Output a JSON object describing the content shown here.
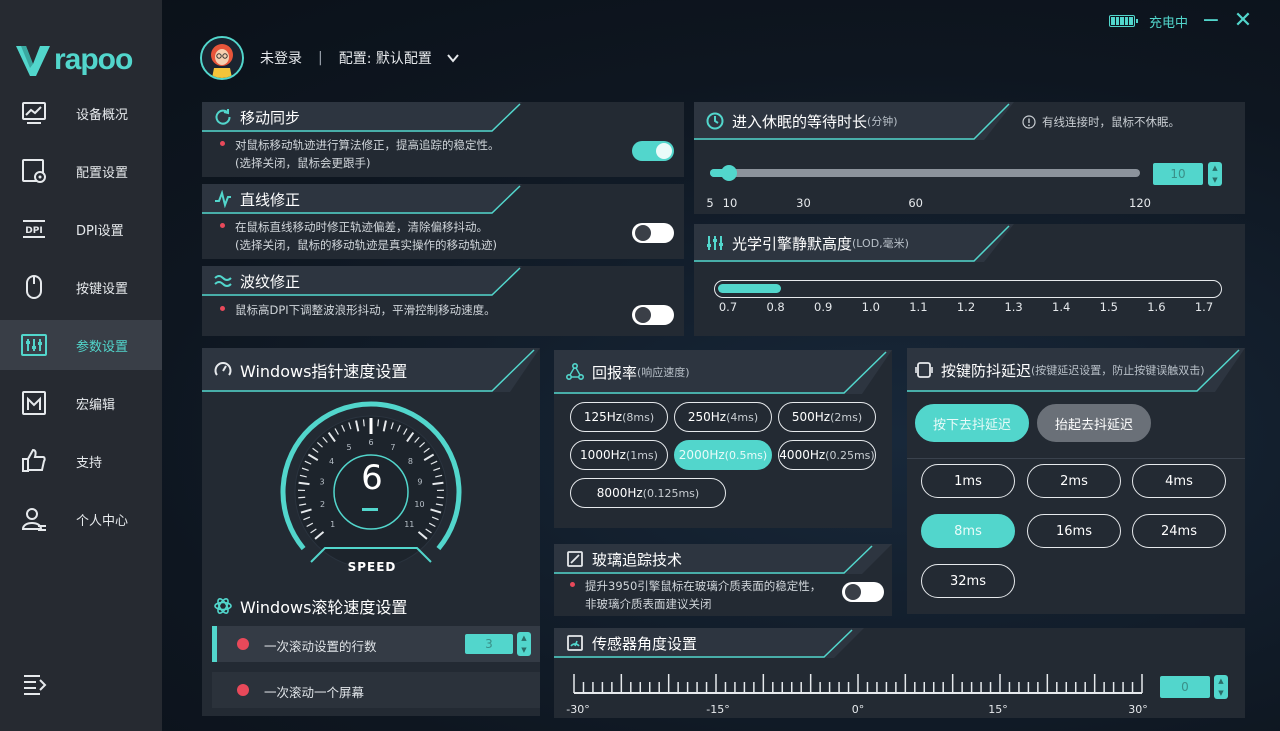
{
  "brand": {
    "name": "rapoo"
  },
  "status": {
    "charging": "充电中"
  },
  "window": {
    "minimize": "−",
    "close": "✕"
  },
  "user": {
    "name": "未登录",
    "separator": "|",
    "profile_label": "配置: 默认配置"
  },
  "sidebar": {
    "items": [
      {
        "label": "设备概况",
        "icon": "monitor-chart-icon",
        "active": false
      },
      {
        "label": "配置设置",
        "icon": "config-gear-icon",
        "active": false
      },
      {
        "label": "DPI设置",
        "icon": "dpi-icon",
        "active": false
      },
      {
        "label": "按键设置",
        "icon": "mouse-icon",
        "active": false
      },
      {
        "label": "参数设置",
        "icon": "sliders-icon",
        "active": true
      },
      {
        "label": "宏编辑",
        "icon": "macro-icon",
        "active": false
      },
      {
        "label": "支持",
        "icon": "thumbs-up-icon",
        "active": false
      },
      {
        "label": "个人中心",
        "icon": "user-icon",
        "active": false
      }
    ]
  },
  "sync": {
    "title": "移动同步",
    "line1": "对鼠标移动轨迹进行算法修正，提高追踪的稳定性。",
    "line2": "(选择关闭，鼠标会更跟手)",
    "enabled": true
  },
  "straight": {
    "title": "直线修正",
    "line1": "在鼠标直线移动时修正轨迹偏差，清除偏移抖动。",
    "line2": "(选择关闭，鼠标的移动轨迹是真实操作的移动轨迹)",
    "enabled": false
  },
  "ripple": {
    "title": "波纹修正",
    "line1": "鼠标高DPI下调整波浪形抖动，平滑控制移动速度。",
    "enabled": false
  },
  "sleep": {
    "title": "进入休眠的等待时长",
    "unit": "(分钟)",
    "note": "有线连接时，鼠标不休眠。",
    "value": "10",
    "min": 5,
    "max": 120,
    "ticks": [
      "5",
      "10",
      "30",
      "60",
      "120"
    ]
  },
  "lod": {
    "title": "光学引擎静默高度",
    "unit": "(LOD,毫米)",
    "value": 0.8,
    "ticks": [
      "0.7",
      "0.8",
      "0.9",
      "1.0",
      "1.1",
      "1.2",
      "1.3",
      "1.4",
      "1.5",
      "1.6",
      "1.7"
    ]
  },
  "pointer": {
    "title": "Windows指针速度设置",
    "value": "6",
    "label": "SPEED",
    "dial_numbers": [
      "1",
      "2",
      "3",
      "4",
      "5",
      "6",
      "7",
      "8",
      "9",
      "10",
      "11"
    ]
  },
  "wheel": {
    "title": "Windows滚轮速度设置",
    "option1": "一次滚动设置的行数",
    "option1_value": "3",
    "option2": "一次滚动一个屏幕"
  },
  "polling": {
    "title": "回报率",
    "subtitle": "(响应速度)",
    "options": [
      {
        "hz": "125Hz",
        "ms": "(8ms)",
        "selected": false
      },
      {
        "hz": "250Hz",
        "ms": "(4ms)",
        "selected": false
      },
      {
        "hz": "500Hz",
        "ms": "(2ms)",
        "selected": false
      },
      {
        "hz": "1000Hz",
        "ms": "(1ms)",
        "selected": false
      },
      {
        "hz": "2000Hz",
        "ms": "(0.5ms)",
        "selected": true
      },
      {
        "hz": "4000Hz",
        "ms": "(0.25ms)",
        "selected": false
      },
      {
        "hz": "8000Hz",
        "ms": "(0.125ms)",
        "selected": false
      }
    ]
  },
  "glass": {
    "title": "玻璃追踪技术",
    "line1": "提升3950引擎鼠标在玻璃介质表面的稳定性，",
    "line2": "非玻璃介质表面建议关闭",
    "enabled": false
  },
  "debounce": {
    "title": "按键防抖延迟",
    "subtitle": "(按键延迟设置，防止按键误触双击)",
    "press_label": "按下去抖延迟",
    "release_label": "抬起去抖延迟",
    "options": [
      {
        "label": "1ms",
        "selected": false
      },
      {
        "label": "2ms",
        "selected": false
      },
      {
        "label": "4ms",
        "selected": false
      },
      {
        "label": "8ms",
        "selected": true
      },
      {
        "label": "16ms",
        "selected": false
      },
      {
        "label": "24ms",
        "selected": false
      },
      {
        "label": "32ms",
        "selected": false
      }
    ]
  },
  "angle": {
    "title": "传感器角度设置",
    "value": "0",
    "ticks": [
      "-30°",
      "-15°",
      "0°",
      "15°",
      "30°"
    ]
  },
  "colors": {
    "accent": "#52d6cc",
    "panel": "#232a33",
    "alert_dot": "#e8495a"
  }
}
